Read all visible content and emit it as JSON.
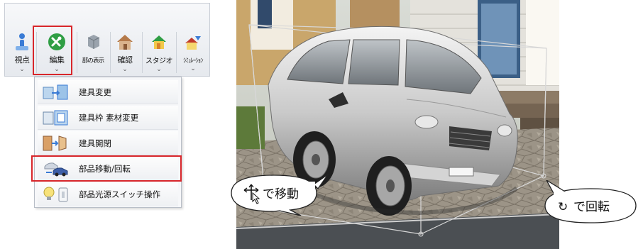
{
  "toolbar": {
    "buttons": [
      {
        "label": "視点",
        "icon": "viewpoint-icon",
        "has_dropdown": true
      },
      {
        "label": "編集",
        "icon": "edit-tools-icon",
        "has_dropdown": true,
        "selected": true
      },
      {
        "label": "部の表示",
        "icon": "parts-display-icon",
        "has_dropdown": false
      },
      {
        "label": "確認",
        "icon": "confirm-house-icon",
        "has_dropdown": true
      },
      {
        "label": "スタジオ",
        "icon": "studio-icon",
        "has_dropdown": true
      },
      {
        "label": "ｼﾐｭﾚｰｼｮﾝ",
        "icon": "simulation-icon",
        "has_dropdown": true
      }
    ],
    "chevron": "⌄"
  },
  "edit_menu": {
    "items": [
      {
        "label": "建具変更",
        "icon": "fitting-change-icon"
      },
      {
        "label": "建具枠 素材変更",
        "icon": "frame-material-icon"
      },
      {
        "label": "建具開閉",
        "icon": "fitting-open-close-icon"
      },
      {
        "label": "部品移動/回転",
        "icon": "part-move-rotate-icon",
        "highlighted": true
      },
      {
        "label": "部品光源スイッチ操作",
        "icon": "light-switch-icon"
      }
    ]
  },
  "callouts": {
    "move": {
      "text": "で移動",
      "icon": "move-cursor-icon"
    },
    "rotate": {
      "text": "で回転",
      "glyph": "↻"
    }
  },
  "colors": {
    "highlight": "#d8262b",
    "edit_icon": "#2f9e44"
  }
}
